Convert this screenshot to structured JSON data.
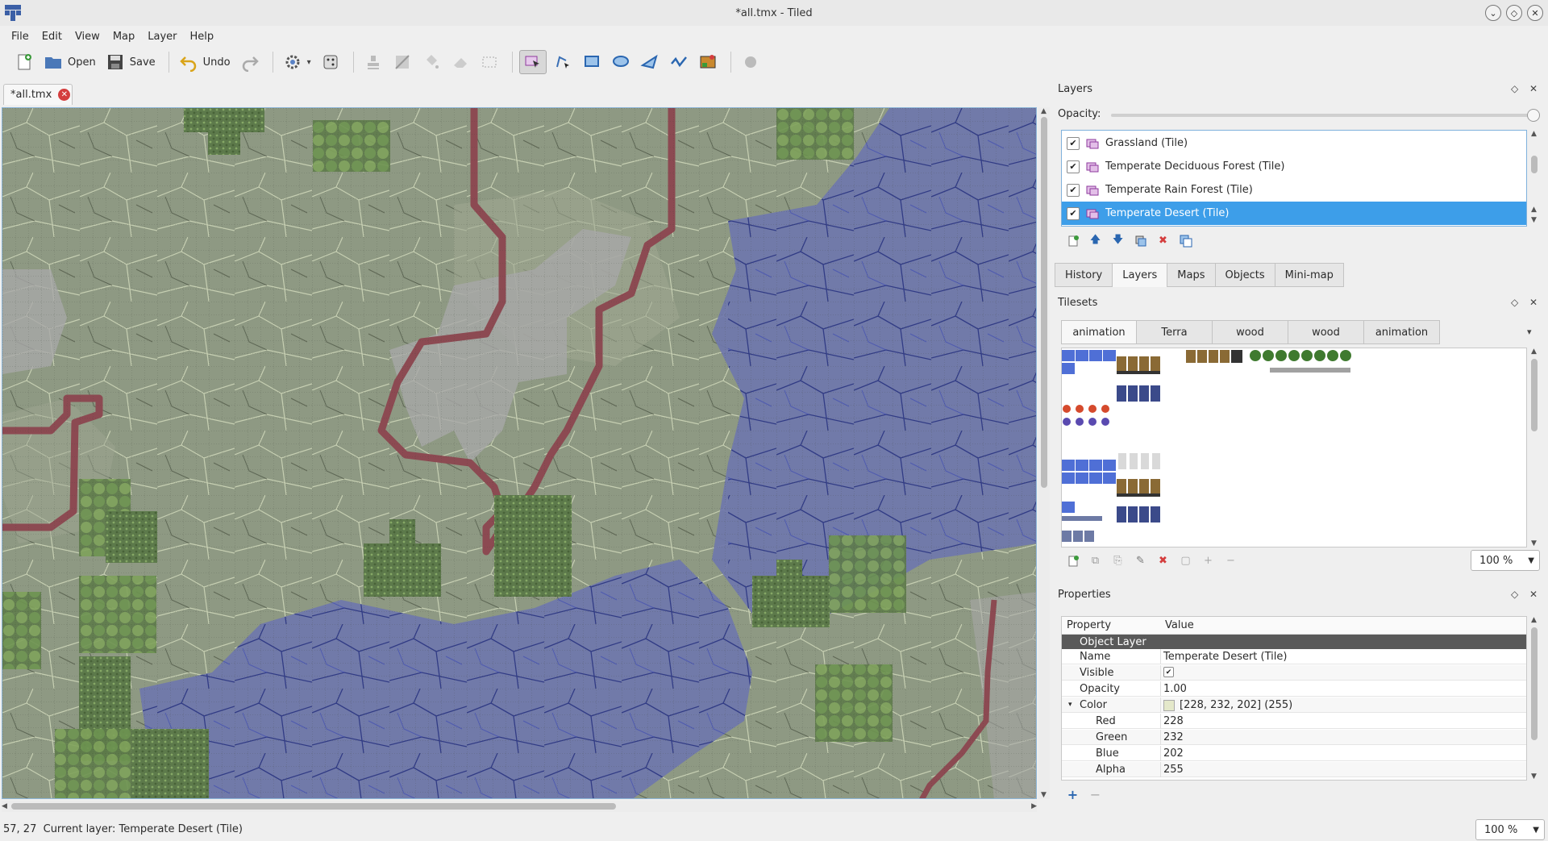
{
  "window": {
    "title": "*all.tmx - Tiled",
    "controls": [
      "minimize",
      "maximize",
      "close"
    ]
  },
  "menu": [
    "File",
    "Edit",
    "View",
    "Map",
    "Layer",
    "Help"
  ],
  "toolbar": {
    "open_label": "Open",
    "save_label": "Save",
    "undo_label": "Undo"
  },
  "document_tab": {
    "label": "*all.tmx"
  },
  "status": {
    "text": "57, 27  Current layer: Temperate Desert (Tile)",
    "zoom": "100 %"
  },
  "layers_panel": {
    "title": "Layers",
    "opacity_label": "Opacity:",
    "opacity": 1.0,
    "layers": [
      {
        "name": "Grassland (Tile)",
        "visible": true,
        "selected": false
      },
      {
        "name": "Temperate Deciduous Forest (Tile)",
        "visible": true,
        "selected": false
      },
      {
        "name": "Temperate Rain Forest (Tile)",
        "visible": true,
        "selected": false
      },
      {
        "name": "Temperate Desert (Tile)",
        "visible": true,
        "selected": true
      }
    ]
  },
  "dock_tabs": {
    "items": [
      "History",
      "Layers",
      "Maps",
      "Objects",
      "Mini-map"
    ],
    "active": "Layers"
  },
  "tilesets_panel": {
    "title": "Tilesets",
    "tabs": [
      "animation",
      "Terra",
      "wood",
      "wood",
      "animation"
    ],
    "active_tab": "animation",
    "zoom": "100 %"
  },
  "properties_panel": {
    "title": "Properties",
    "col_property": "Property",
    "col_value": "Value",
    "group": "Object Layer",
    "name_key": "Name",
    "name_value": "Temperate Desert (Tile)",
    "visible_key": "Visible",
    "opacity_key": "Opacity",
    "opacity_value": "1.00",
    "color_key": "Color",
    "color_value": "[228, 232, 202] (255)",
    "color_hex": "#e4e8ca",
    "red_key": "Red",
    "red_value": "228",
    "green_key": "Green",
    "green_value": "232",
    "blue_key": "Blue",
    "blue_value": "202",
    "alpha_key": "Alpha",
    "alpha_value": "255"
  },
  "colors": {
    "selection": "#3d9ee9",
    "map_grass": "#8e9983",
    "map_water": "#6f77ad",
    "map_wall": "#8c4a52",
    "map_stone": "#a7a7a7"
  }
}
